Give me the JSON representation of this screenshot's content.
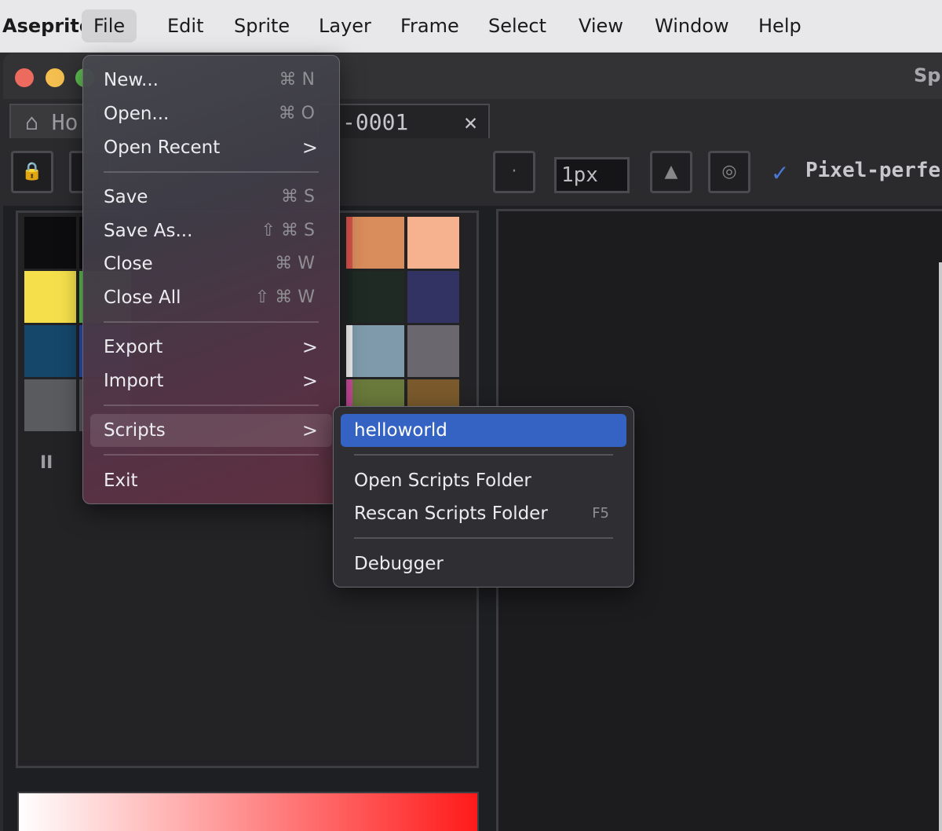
{
  "menubar": {
    "app_label": "Aseprite",
    "items": [
      "File",
      "Edit",
      "Sprite",
      "Layer",
      "Frame",
      "Select",
      "View",
      "Window",
      "Help"
    ]
  },
  "window": {
    "title": "Sp",
    "tabs": {
      "home": "Ho",
      "doc": "-0001",
      "close_glyph": "✕"
    },
    "toolbar": {
      "brush_size": "1px",
      "pixel_perfect_label": "Pixel-perfect",
      "pixel_perfect_checked": true
    },
    "palette_colors": [
      "#0d0d0f",
      "#0d0d0f",
      "#d9534b",
      "#d98c5c",
      "#f6b28e",
      "#f5e04c",
      "#5cc84b",
      "#1b2621",
      "#1e2a23",
      "#323263",
      "#15476b",
      "#2b4fb7",
      "#f0f0f0",
      "#7f9bab",
      "#6a686e",
      "#5a5b5e",
      "#5a5b5e",
      "#c84a9a",
      "#6a7a3c",
      "#7a5a2c"
    ],
    "pause_glyph": "II"
  },
  "file_menu": {
    "items": [
      {
        "label": "New...",
        "shortcut": "⌘ N"
      },
      {
        "label": "Open...",
        "shortcut": "⌘ O"
      },
      {
        "label": "Open Recent",
        "submenu": true
      },
      {
        "label": "Save",
        "shortcut": "⌘ S"
      },
      {
        "label": "Save As...",
        "shortcut": "⇧ ⌘ S"
      },
      {
        "label": "Close",
        "shortcut": "⌘ W"
      },
      {
        "label": "Close All",
        "shortcut": "⇧ ⌘ W"
      },
      {
        "label": "Export",
        "submenu": true
      },
      {
        "label": "Import",
        "submenu": true
      },
      {
        "label": "Scripts",
        "submenu": true,
        "hovered": true
      },
      {
        "label": "Exit"
      }
    ]
  },
  "scripts_menu": {
    "items": [
      {
        "label": "helloworld",
        "selected": true
      },
      {
        "label": "Open Scripts Folder"
      },
      {
        "label": "Rescan Scripts Folder",
        "shortcut": "F5"
      },
      {
        "label": "Debugger"
      }
    ]
  },
  "icons": {
    "submenu_arrow": ">",
    "home": "⌂",
    "lock": "🔒",
    "check": "✓"
  },
  "colors": {
    "selected_highlight": "#3463c4",
    "menubar_bg": "#e8e8ea",
    "window_bg": "#1e1f22"
  }
}
